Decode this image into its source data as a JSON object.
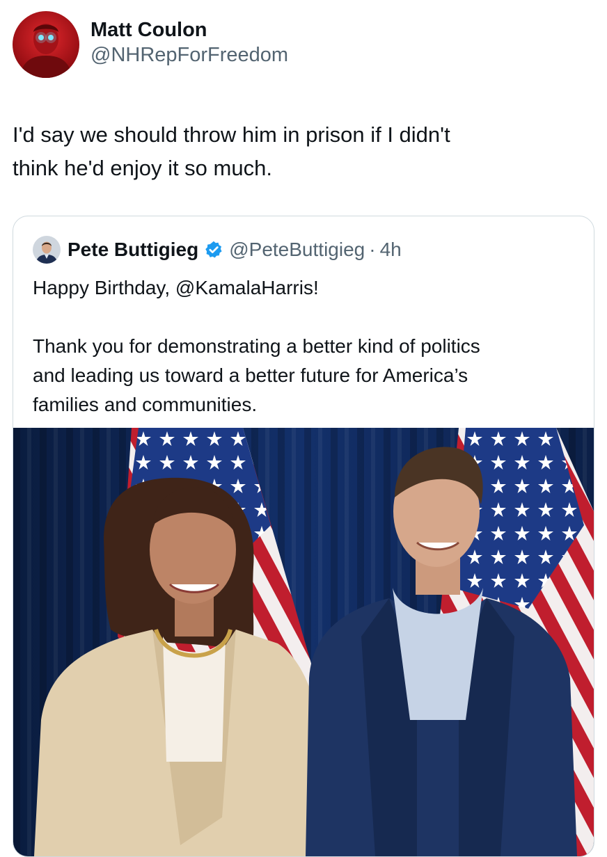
{
  "tweet": {
    "author": {
      "name": "Matt Coulon",
      "handle": "@NHRepForFreedom"
    },
    "text_lines": [
      "I'd say we should throw him in prison if I didn't",
      "think he'd enjoy it so much."
    ]
  },
  "quoted_tweet": {
    "author_name": "Pete Buttigieg",
    "verified": true,
    "handle": "@PeteButtigieg",
    "separator": "·",
    "time": "4h",
    "text_line_1": "Happy Birthday, @KamalaHarris!",
    "text_lines_2": [
      "Thank you for demonstrating a better kind of politics",
      "and leading us toward a better future for America’s",
      "families and communities."
    ],
    "media": {
      "type": "photo"
    }
  },
  "icons": {
    "verified": "verified-badge-icon"
  },
  "colors": {
    "text_primary": "#0f1419",
    "text_secondary": "#536471",
    "verified_blue": "#1d9bf0",
    "card_border": "#cfd9de",
    "avatar_red": "#c4161c"
  }
}
